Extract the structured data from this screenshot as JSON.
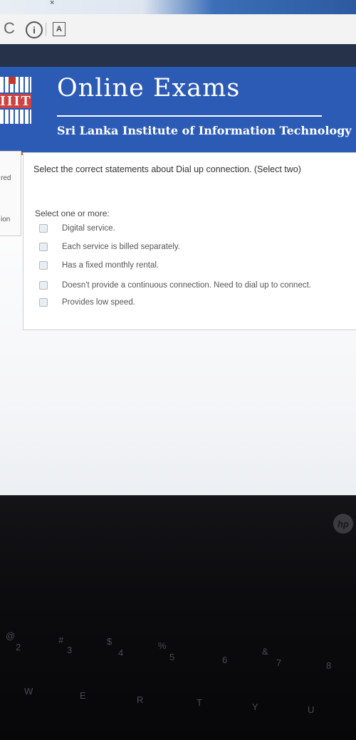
{
  "browser": {
    "tab_close": "×",
    "reload_glyph": "C",
    "info_glyph": "i",
    "page_glyph": "A"
  },
  "site": {
    "logo_text": "IIIT",
    "title": "Online Exams",
    "subtitle": "Sri Lanka Institute of Information Technology",
    "accent": "#2c5bb5",
    "rule_color": "#d96a2a"
  },
  "nav": {
    "status_fragment": "red",
    "link_fragment": "ion"
  },
  "question": {
    "text": "Select the correct statements about Dial up connection. (Select two)",
    "prompt": "Select one or more:",
    "options": [
      {
        "label": "Digital service.",
        "checked": false
      },
      {
        "label": "Each service is billed separately.",
        "checked": false
      },
      {
        "label": "Has a fixed monthly rental.",
        "checked": false
      },
      {
        "label": "Doesn't provide a continuous connection. Need to dial up to connect.",
        "checked": false
      },
      {
        "label": "Provides low speed.",
        "checked": false
      }
    ]
  },
  "laptop": {
    "brand": "hp",
    "keys_numbers": [
      "@",
      "2",
      "#",
      "3",
      "$",
      "4",
      "%",
      "5",
      "6",
      "&",
      "7",
      "8"
    ],
    "keys_letters": [
      "W",
      "E",
      "R",
      "T",
      "Y",
      "U"
    ]
  }
}
